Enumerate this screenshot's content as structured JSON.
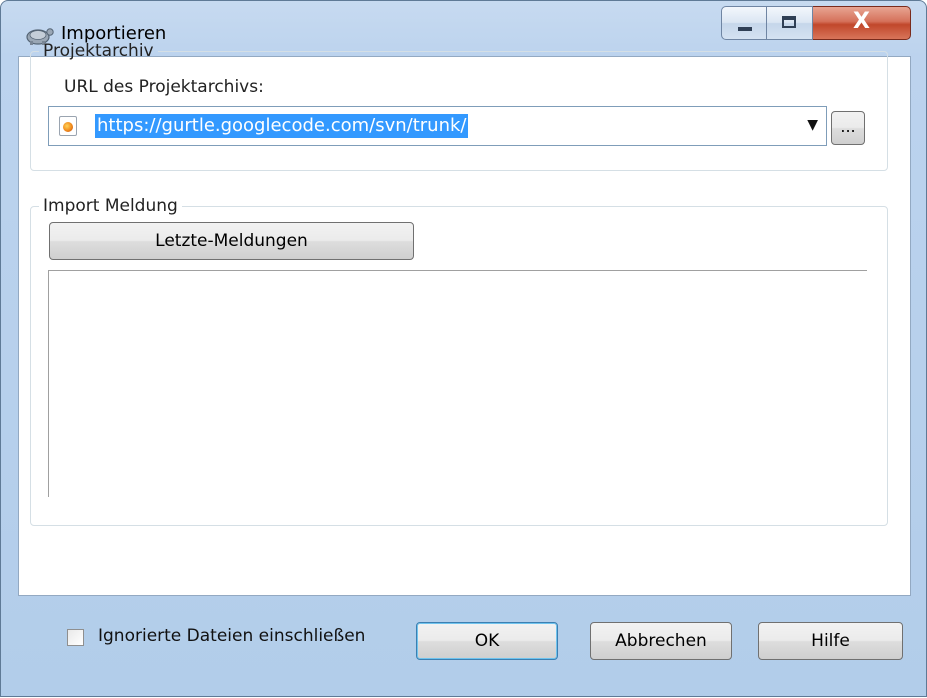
{
  "window": {
    "title": "Importieren",
    "controls": {
      "minimize": "minimize",
      "maximize": "maximize",
      "close": "X"
    }
  },
  "repository_group": {
    "legend": "Projektarchiv",
    "url_label": "URL des Projektarchivs:",
    "url_value": "https://gurtle.googlecode.com/svn/trunk/",
    "browse_label": "...",
    "dropdown_arrow": "▼"
  },
  "message_group": {
    "legend": "Import Meldung",
    "recent_messages_label": "Letzte-Meldungen",
    "message_text": ""
  },
  "footer": {
    "include_ignored_label": "Ignorierte Dateien einschließen",
    "include_ignored_checked": false,
    "ok_label": "OK",
    "cancel_label": "Abbrechen",
    "help_label": "Hilfe"
  },
  "colors": {
    "selection": "#3399ff",
    "frame": "#bcd3ee",
    "close_button": "#c1472b"
  }
}
